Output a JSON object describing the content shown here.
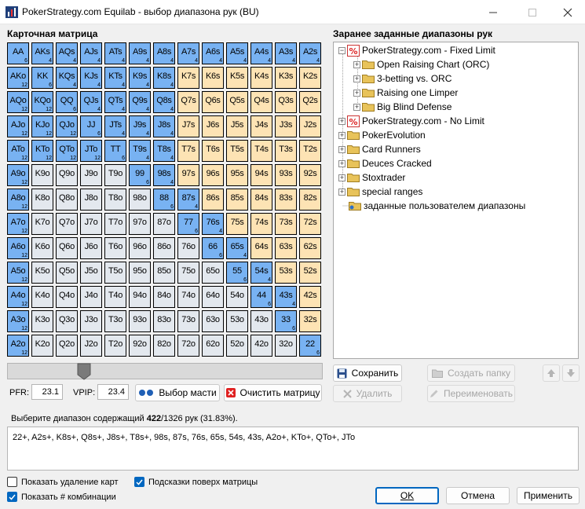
{
  "window": {
    "title": "PokerStrategy.com Equilab - выбор диапазона рук (BU)"
  },
  "matrix": {
    "title": "Карточная матрица",
    "cells": [
      [
        {
          "t": "AA",
          "c": "6",
          "s": 1
        },
        {
          "t": "AKs",
          "c": "4",
          "s": 1
        },
        {
          "t": "AQs",
          "c": "4",
          "s": 1
        },
        {
          "t": "AJs",
          "c": "4",
          "s": 1
        },
        {
          "t": "ATs",
          "c": "4",
          "s": 1
        },
        {
          "t": "A9s",
          "c": "4",
          "s": 1
        },
        {
          "t": "A8s",
          "c": "4",
          "s": 1
        },
        {
          "t": "A7s",
          "c": "4",
          "s": 1
        },
        {
          "t": "A6s",
          "c": "4",
          "s": 1
        },
        {
          "t": "A5s",
          "c": "4",
          "s": 1
        },
        {
          "t": "A4s",
          "c": "4",
          "s": 1
        },
        {
          "t": "A3s",
          "c": "4",
          "s": 1
        },
        {
          "t": "A2s",
          "c": "4",
          "s": 1
        }
      ],
      [
        {
          "t": "AKo",
          "c": "12",
          "s": 1
        },
        {
          "t": "KK",
          "c": "6",
          "s": 1
        },
        {
          "t": "KQs",
          "c": "4",
          "s": 1
        },
        {
          "t": "KJs",
          "c": "4",
          "s": 1
        },
        {
          "t": "KTs",
          "c": "4",
          "s": 1
        },
        {
          "t": "K9s",
          "c": "4",
          "s": 1
        },
        {
          "t": "K8s",
          "c": "4",
          "s": 1
        },
        {
          "t": "K7s",
          "c": "",
          "s": 0
        },
        {
          "t": "K6s",
          "c": "",
          "s": 0
        },
        {
          "t": "K5s",
          "c": "",
          "s": 0
        },
        {
          "t": "K4s",
          "c": "",
          "s": 0
        },
        {
          "t": "K3s",
          "c": "",
          "s": 0
        },
        {
          "t": "K2s",
          "c": "",
          "s": 0
        }
      ],
      [
        {
          "t": "AQo",
          "c": "12",
          "s": 1
        },
        {
          "t": "KQo",
          "c": "12",
          "s": 1
        },
        {
          "t": "QQ",
          "c": "6",
          "s": 1
        },
        {
          "t": "QJs",
          "c": "4",
          "s": 1
        },
        {
          "t": "QTs",
          "c": "4",
          "s": 1
        },
        {
          "t": "Q9s",
          "c": "4",
          "s": 1
        },
        {
          "t": "Q8s",
          "c": "4",
          "s": 1
        },
        {
          "t": "Q7s",
          "c": "",
          "s": 0
        },
        {
          "t": "Q6s",
          "c": "",
          "s": 0
        },
        {
          "t": "Q5s",
          "c": "",
          "s": 0
        },
        {
          "t": "Q4s",
          "c": "",
          "s": 0
        },
        {
          "t": "Q3s",
          "c": "",
          "s": 0
        },
        {
          "t": "Q2s",
          "c": "",
          "s": 0
        }
      ],
      [
        {
          "t": "AJo",
          "c": "12",
          "s": 1
        },
        {
          "t": "KJo",
          "c": "12",
          "s": 1
        },
        {
          "t": "QJo",
          "c": "12",
          "s": 1
        },
        {
          "t": "JJ",
          "c": "6",
          "s": 1
        },
        {
          "t": "JTs",
          "c": "4",
          "s": 1
        },
        {
          "t": "J9s",
          "c": "4",
          "s": 1
        },
        {
          "t": "J8s",
          "c": "4",
          "s": 1
        },
        {
          "t": "J7s",
          "c": "",
          "s": 0
        },
        {
          "t": "J6s",
          "c": "",
          "s": 0
        },
        {
          "t": "J5s",
          "c": "",
          "s": 0
        },
        {
          "t": "J4s",
          "c": "",
          "s": 0
        },
        {
          "t": "J3s",
          "c": "",
          "s": 0
        },
        {
          "t": "J2s",
          "c": "",
          "s": 0
        }
      ],
      [
        {
          "t": "ATo",
          "c": "12",
          "s": 1
        },
        {
          "t": "KTo",
          "c": "12",
          "s": 1
        },
        {
          "t": "QTo",
          "c": "12",
          "s": 1
        },
        {
          "t": "JTo",
          "c": "12",
          "s": 1
        },
        {
          "t": "TT",
          "c": "6",
          "s": 1
        },
        {
          "t": "T9s",
          "c": "4",
          "s": 1
        },
        {
          "t": "T8s",
          "c": "4",
          "s": 1
        },
        {
          "t": "T7s",
          "c": "",
          "s": 0
        },
        {
          "t": "T6s",
          "c": "",
          "s": 0
        },
        {
          "t": "T5s",
          "c": "",
          "s": 0
        },
        {
          "t": "T4s",
          "c": "",
          "s": 0
        },
        {
          "t": "T3s",
          "c": "",
          "s": 0
        },
        {
          "t": "T2s",
          "c": "",
          "s": 0
        }
      ],
      [
        {
          "t": "A9o",
          "c": "12",
          "s": 1
        },
        {
          "t": "K9o",
          "c": "",
          "s": 0
        },
        {
          "t": "Q9o",
          "c": "",
          "s": 0
        },
        {
          "t": "J9o",
          "c": "",
          "s": 0
        },
        {
          "t": "T9o",
          "c": "",
          "s": 0
        },
        {
          "t": "99",
          "c": "6",
          "s": 1
        },
        {
          "t": "98s",
          "c": "4",
          "s": 1
        },
        {
          "t": "97s",
          "c": "",
          "s": 0
        },
        {
          "t": "96s",
          "c": "",
          "s": 0
        },
        {
          "t": "95s",
          "c": "",
          "s": 0
        },
        {
          "t": "94s",
          "c": "",
          "s": 0
        },
        {
          "t": "93s",
          "c": "",
          "s": 0
        },
        {
          "t": "92s",
          "c": "",
          "s": 0
        }
      ],
      [
        {
          "t": "A8o",
          "c": "12",
          "s": 1
        },
        {
          "t": "K8o",
          "c": "",
          "s": 0
        },
        {
          "t": "Q8o",
          "c": "",
          "s": 0
        },
        {
          "t": "J8o",
          "c": "",
          "s": 0
        },
        {
          "t": "T8o",
          "c": "",
          "s": 0
        },
        {
          "t": "98o",
          "c": "",
          "s": 0
        },
        {
          "t": "88",
          "c": "6",
          "s": 1
        },
        {
          "t": "87s",
          "c": "4",
          "s": 1
        },
        {
          "t": "86s",
          "c": "",
          "s": 0
        },
        {
          "t": "85s",
          "c": "",
          "s": 0
        },
        {
          "t": "84s",
          "c": "",
          "s": 0
        },
        {
          "t": "83s",
          "c": "",
          "s": 0
        },
        {
          "t": "82s",
          "c": "",
          "s": 0
        }
      ],
      [
        {
          "t": "A7o",
          "c": "12",
          "s": 1
        },
        {
          "t": "K7o",
          "c": "",
          "s": 0
        },
        {
          "t": "Q7o",
          "c": "",
          "s": 0
        },
        {
          "t": "J7o",
          "c": "",
          "s": 0
        },
        {
          "t": "T7o",
          "c": "",
          "s": 0
        },
        {
          "t": "97o",
          "c": "",
          "s": 0
        },
        {
          "t": "87o",
          "c": "",
          "s": 0
        },
        {
          "t": "77",
          "c": "6",
          "s": 1
        },
        {
          "t": "76s",
          "c": "4",
          "s": 1
        },
        {
          "t": "75s",
          "c": "",
          "s": 0
        },
        {
          "t": "74s",
          "c": "",
          "s": 0
        },
        {
          "t": "73s",
          "c": "",
          "s": 0
        },
        {
          "t": "72s",
          "c": "",
          "s": 0
        }
      ],
      [
        {
          "t": "A6o",
          "c": "12",
          "s": 1
        },
        {
          "t": "K6o",
          "c": "",
          "s": 0
        },
        {
          "t": "Q6o",
          "c": "",
          "s": 0
        },
        {
          "t": "J6o",
          "c": "",
          "s": 0
        },
        {
          "t": "T6o",
          "c": "",
          "s": 0
        },
        {
          "t": "96o",
          "c": "",
          "s": 0
        },
        {
          "t": "86o",
          "c": "",
          "s": 0
        },
        {
          "t": "76o",
          "c": "",
          "s": 0
        },
        {
          "t": "66",
          "c": "6",
          "s": 1
        },
        {
          "t": "65s",
          "c": "4",
          "s": 1
        },
        {
          "t": "64s",
          "c": "",
          "s": 0
        },
        {
          "t": "63s",
          "c": "",
          "s": 0
        },
        {
          "t": "62s",
          "c": "",
          "s": 0
        }
      ],
      [
        {
          "t": "A5o",
          "c": "12",
          "s": 1
        },
        {
          "t": "K5o",
          "c": "",
          "s": 0
        },
        {
          "t": "Q5o",
          "c": "",
          "s": 0
        },
        {
          "t": "J5o",
          "c": "",
          "s": 0
        },
        {
          "t": "T5o",
          "c": "",
          "s": 0
        },
        {
          "t": "95o",
          "c": "",
          "s": 0
        },
        {
          "t": "85o",
          "c": "",
          "s": 0
        },
        {
          "t": "75o",
          "c": "",
          "s": 0
        },
        {
          "t": "65o",
          "c": "",
          "s": 0
        },
        {
          "t": "55",
          "c": "6",
          "s": 1
        },
        {
          "t": "54s",
          "c": "4",
          "s": 1
        },
        {
          "t": "53s",
          "c": "",
          "s": 0
        },
        {
          "t": "52s",
          "c": "",
          "s": 0
        }
      ],
      [
        {
          "t": "A4o",
          "c": "12",
          "s": 1
        },
        {
          "t": "K4o",
          "c": "",
          "s": 0
        },
        {
          "t": "Q4o",
          "c": "",
          "s": 0
        },
        {
          "t": "J4o",
          "c": "",
          "s": 0
        },
        {
          "t": "T4o",
          "c": "",
          "s": 0
        },
        {
          "t": "94o",
          "c": "",
          "s": 0
        },
        {
          "t": "84o",
          "c": "",
          "s": 0
        },
        {
          "t": "74o",
          "c": "",
          "s": 0
        },
        {
          "t": "64o",
          "c": "",
          "s": 0
        },
        {
          "t": "54o",
          "c": "",
          "s": 0
        },
        {
          "t": "44",
          "c": "6",
          "s": 1
        },
        {
          "t": "43s",
          "c": "4",
          "s": 1
        },
        {
          "t": "42s",
          "c": "",
          "s": 0
        }
      ],
      [
        {
          "t": "A3o",
          "c": "12",
          "s": 1
        },
        {
          "t": "K3o",
          "c": "",
          "s": 0
        },
        {
          "t": "Q3o",
          "c": "",
          "s": 0
        },
        {
          "t": "J3o",
          "c": "",
          "s": 0
        },
        {
          "t": "T3o",
          "c": "",
          "s": 0
        },
        {
          "t": "93o",
          "c": "",
          "s": 0
        },
        {
          "t": "83o",
          "c": "",
          "s": 0
        },
        {
          "t": "73o",
          "c": "",
          "s": 0
        },
        {
          "t": "63o",
          "c": "",
          "s": 0
        },
        {
          "t": "53o",
          "c": "",
          "s": 0
        },
        {
          "t": "43o",
          "c": "",
          "s": 0
        },
        {
          "t": "33",
          "c": "6",
          "s": 1
        },
        {
          "t": "32s",
          "c": "",
          "s": 0
        }
      ],
      [
        {
          "t": "A2o",
          "c": "12",
          "s": 1
        },
        {
          "t": "K2o",
          "c": "",
          "s": 0
        },
        {
          "t": "Q2o",
          "c": "",
          "s": 0
        },
        {
          "t": "J2o",
          "c": "",
          "s": 0
        },
        {
          "t": "T2o",
          "c": "",
          "s": 0
        },
        {
          "t": "92o",
          "c": "",
          "s": 0
        },
        {
          "t": "82o",
          "c": "",
          "s": 0
        },
        {
          "t": "72o",
          "c": "",
          "s": 0
        },
        {
          "t": "62o",
          "c": "",
          "s": 0
        },
        {
          "t": "52o",
          "c": "",
          "s": 0
        },
        {
          "t": "42o",
          "c": "",
          "s": 0
        },
        {
          "t": "32o",
          "c": "",
          "s": 0
        },
        {
          "t": "22",
          "c": "6",
          "s": 1
        }
      ]
    ]
  },
  "stats": {
    "pfr_label": "PFR:",
    "pfr_value": "23.1",
    "vpip_label": "VPIP:",
    "vpip_value": "23.4"
  },
  "buttons": {
    "suits": "Выбор масти",
    "clear": "Очистить матрицу",
    "save": "Сохранить",
    "create_folder": "Создать папку",
    "delete": "Удалить",
    "rename": "Переименовать",
    "ok": "OK",
    "cancel": "Отмена",
    "apply": "Применить"
  },
  "tree": {
    "title": "Заранее заданные диапазоны рук",
    "nodes": [
      "PokerStrategy.com - Fixed Limit",
      "Open Raising Chart (ORC)",
      "3-betting vs. ORC",
      "Raising one Limper",
      "Big Blind Defense",
      "PokerStrategy.com - No Limit",
      "PokerEvolution",
      "Card Runners",
      "Deuces Cracked",
      "Stoxtrader",
      "special ranges",
      "заданные пользователем диапазоны"
    ]
  },
  "selection": {
    "prefix": "Выберите диапазон содержащий ",
    "count": "422",
    "suffix": "/1326 рук (31.83%).",
    "range_text": "22+, A2s+, K8s+, Q8s+, J8s+, T8s+, 98s, 87s, 76s, 65s, 54s, 43s, A2o+, KTo+, QTo+, JTo"
  },
  "options": {
    "show_removal": "Показать удаление карт",
    "hints": "Подсказки поверх матрицы",
    "show_combos": "Показать # комбинации"
  },
  "colors": {
    "selected": "#78b2f2",
    "pair": "#ccdbe8",
    "suited": "#fde3b4",
    "offsuit": "#e3e8ee",
    "accent": "#0067c0"
  }
}
